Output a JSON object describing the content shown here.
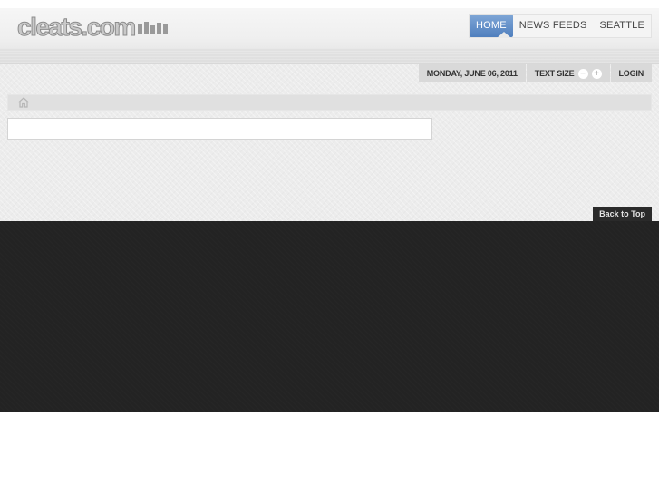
{
  "header": {
    "logo_text": "cleats.com",
    "nav": [
      {
        "label": "HOME",
        "active": true
      },
      {
        "label": "NEWS FEEDS",
        "active": false
      },
      {
        "label": "SEATTLE",
        "active": false
      }
    ]
  },
  "utility": {
    "date": "MONDAY, JUNE 06, 2011",
    "text_size_label": "TEXT SIZE",
    "decrease_symbol": "−",
    "increase_symbol": "+",
    "login_label": "LOGIN"
  },
  "breadcrumb": {
    "icon": "home-icon"
  },
  "back_to_top": "Back to Top",
  "colors": {
    "nav_active": "#5b89c6",
    "footer_bg": "#232323",
    "util_bg": "#d9d9d9"
  }
}
